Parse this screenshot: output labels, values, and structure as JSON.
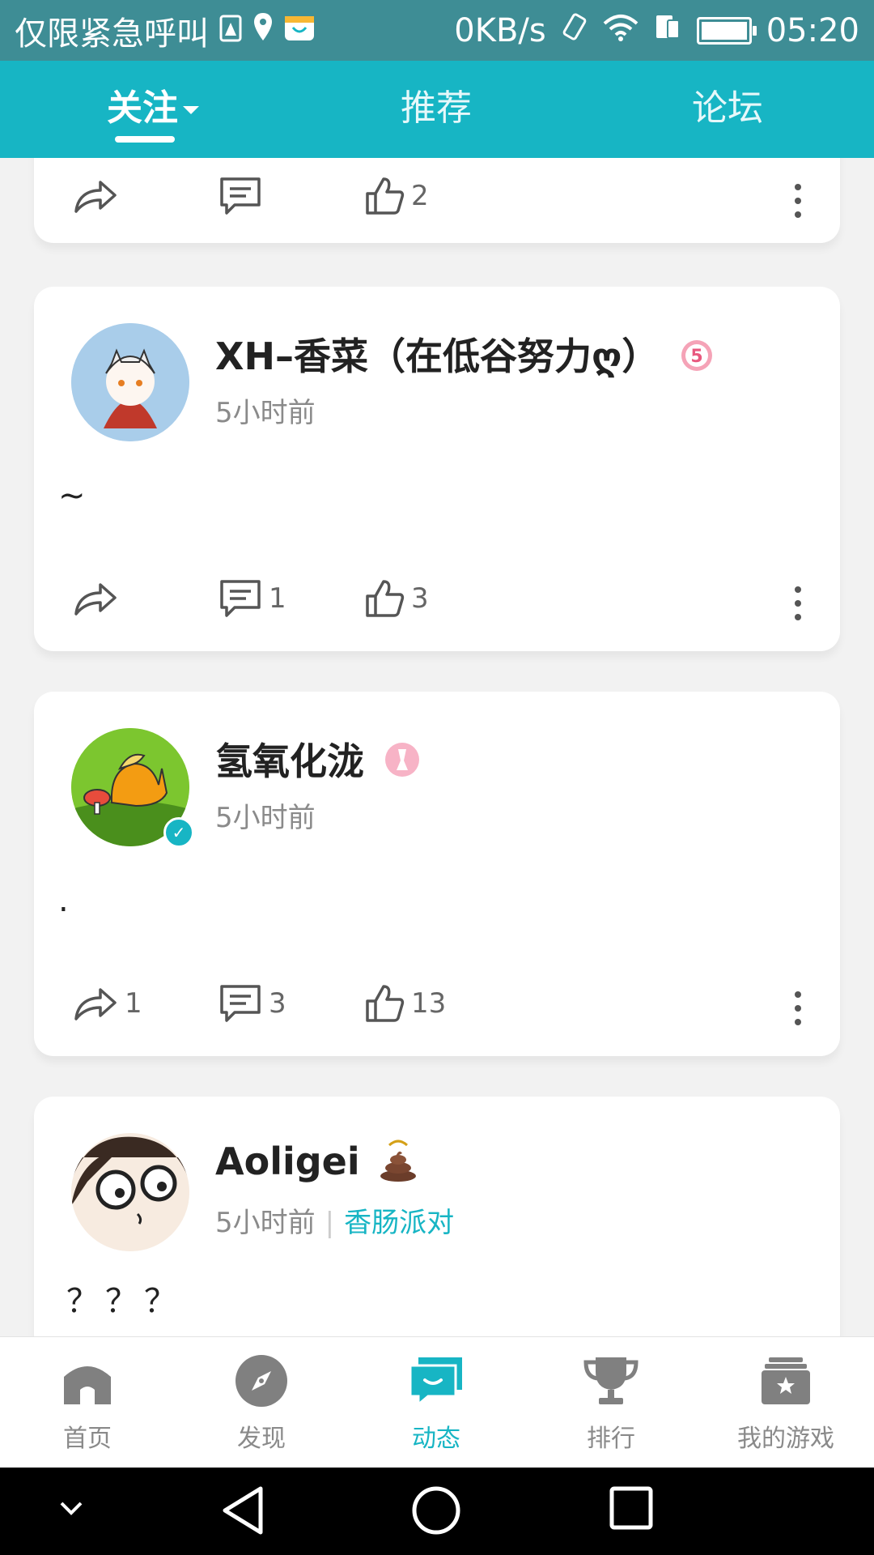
{
  "status_bar": {
    "left_text": "仅限紧急呼叫",
    "speed": "0KB/s",
    "time": "05:20"
  },
  "header": {
    "tabs": [
      {
        "label": "关注",
        "active": true
      },
      {
        "label": "推荐",
        "active": false
      },
      {
        "label": "论坛",
        "active": false
      }
    ]
  },
  "posts": [
    {
      "partial": true,
      "share_count": "",
      "comment_count": "",
      "like_count": "2"
    },
    {
      "username": "XH–香菜（在低谷努力ღ）",
      "time": "5小时前",
      "topic": "",
      "content": "~",
      "share_count": "",
      "comment_count": "1",
      "like_count": "3",
      "badge_icon": "number-five-badge-icon"
    },
    {
      "username": "氢氧化泷",
      "time": "5小时前",
      "topic": "",
      "content": ".",
      "share_count": "1",
      "comment_count": "3",
      "like_count": "13",
      "badge_icon": "pink-medal-badge-icon",
      "verified": true
    },
    {
      "username": "Aoligei",
      "time": "5小时前",
      "topic": "香肠派对",
      "content": "？？？",
      "badge_icon": "poop-emoji-icon"
    }
  ],
  "bottom_nav": [
    {
      "label": "首页",
      "icon": "home-icon"
    },
    {
      "label": "发现",
      "icon": "compass-icon"
    },
    {
      "label": "动态",
      "icon": "chat-bubble-icon",
      "active": true
    },
    {
      "label": "排行",
      "icon": "trophy-icon"
    },
    {
      "label": "我的游戏",
      "icon": "game-box-icon"
    }
  ],
  "colors": {
    "accent": "#17b5c4",
    "status_bar": "#3e8d95",
    "background": "#f2f2f2"
  }
}
